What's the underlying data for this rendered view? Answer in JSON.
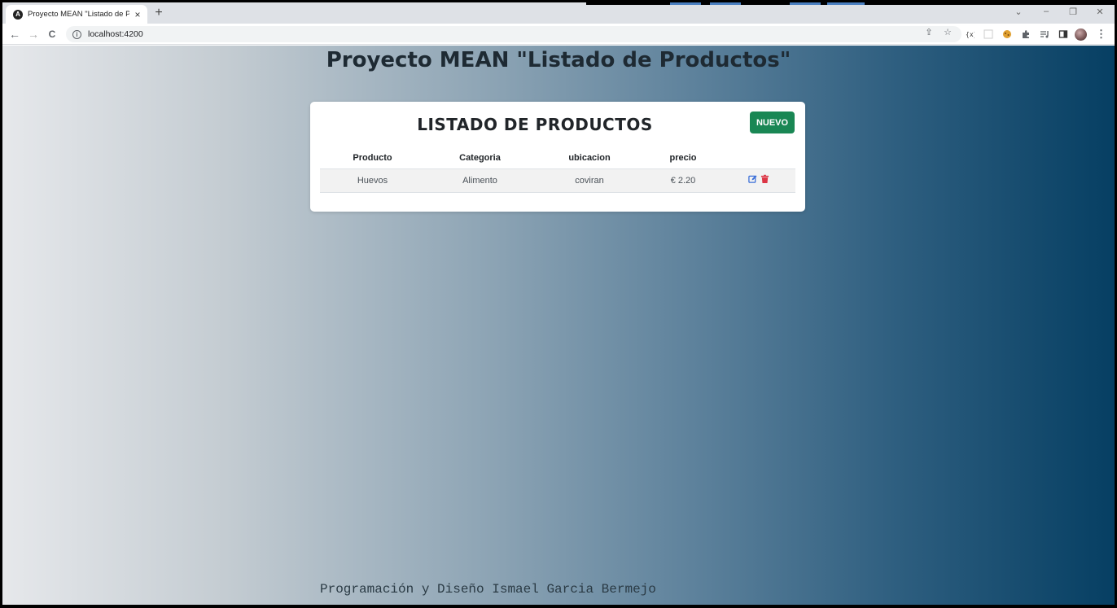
{
  "browser": {
    "tab_title": "Proyecto MEAN \"Listado de Productos\"",
    "favicon_letter": "A",
    "close_glyph": "×",
    "new_tab_glyph": "+",
    "url": "localhost:4200",
    "nav": {
      "back": "←",
      "forward": "→",
      "reload": "C"
    },
    "window_controls": {
      "dropdown": "⌄",
      "minimize": "–",
      "restore": "❐",
      "close": "✕"
    },
    "omni_icons": {
      "share": "⇪",
      "star": "☆"
    },
    "ext_icons": [
      "code-ext-icon",
      "blank-ext-icon",
      "cookie-ext-icon",
      "puzzle-icon",
      "media-icon",
      "sidebar-icon"
    ],
    "menu_glyph": "⋮"
  },
  "page": {
    "title": "Proyecto MEAN \"Listado de Productos\"",
    "card_title": "LISTADO DE PRODUCTOS",
    "new_button": "NUEVO",
    "table": {
      "headers": [
        "Producto",
        "Categoria",
        "ubicacion",
        "precio",
        ""
      ],
      "rows": [
        {
          "producto": "Huevos",
          "categoria": "Alimento",
          "ubicacion": "coviran",
          "precio": "€ 2.20"
        }
      ]
    },
    "footer": "Programación y Diseño Ismael Garcia Bermejo"
  },
  "colors": {
    "success": "#198754",
    "edit": "#3b6fd8",
    "delete": "#dc3545",
    "gradient_start": "#e6e8eb",
    "gradient_end": "#063f63"
  }
}
